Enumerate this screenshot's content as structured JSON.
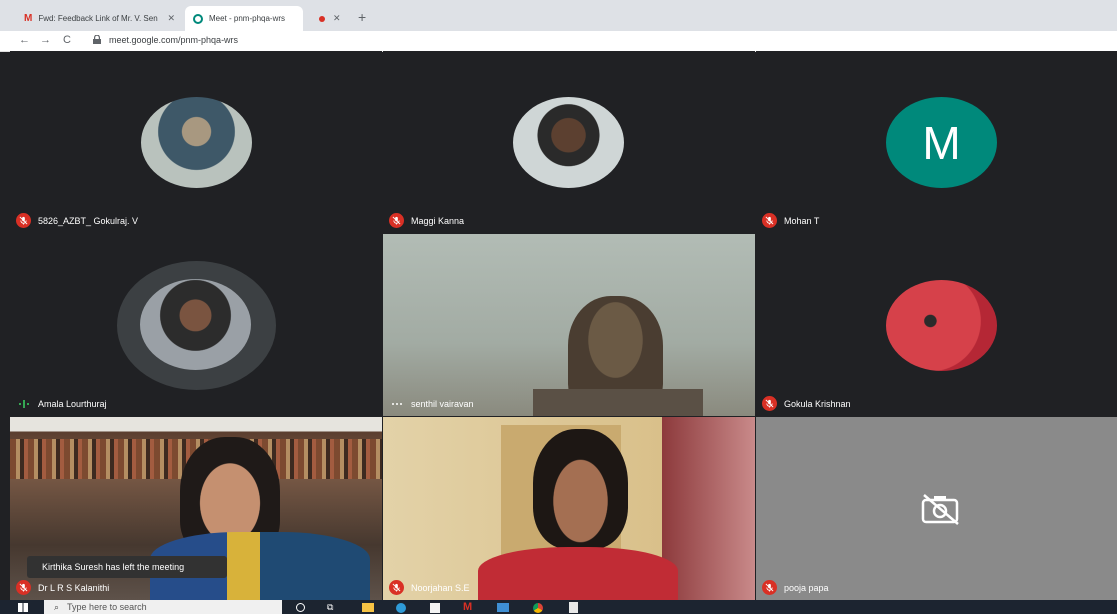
{
  "browser": {
    "tabs": [
      {
        "title": "Fwd: Feedback Link of Mr. V. Sen",
        "icon": "gmail-icon"
      },
      {
        "title": "Meet - pnm-phqa-wrs",
        "icon": "meet-icon"
      },
      {
        "title": "",
        "icon": "recording-dot-icon"
      }
    ],
    "new_tab_icon": "plus-icon",
    "url": "meet.google.com/pnm-phqa-wrs"
  },
  "participants": [
    {
      "name": "5826_AZBT_ Gokulraj. V",
      "status": "muted",
      "display": "avatar-photo"
    },
    {
      "name": "Maggi Kanna",
      "status": "muted",
      "display": "avatar-photo"
    },
    {
      "name": "Mohan T",
      "status": "muted",
      "display": "initial",
      "initial": "M",
      "color": "#00897b"
    },
    {
      "name": "Amala Lourthuraj",
      "status": "speaking",
      "display": "avatar-photo"
    },
    {
      "name": "senthil vairavan",
      "status": "active",
      "display": "video"
    },
    {
      "name": "Gokula Krishnan",
      "status": "muted",
      "display": "avatar-photo"
    },
    {
      "name": "Dr L R S Kalanithi",
      "status": "muted",
      "display": "video"
    },
    {
      "name": "Noorjahan S.E",
      "status": "muted",
      "display": "video"
    },
    {
      "name": "pooja papa",
      "status": "muted",
      "display": "camera-off"
    }
  ],
  "notification": {
    "text": "Kirthika Suresh has left the meeting"
  },
  "taskbar": {
    "search_placeholder": "Type here to search"
  }
}
